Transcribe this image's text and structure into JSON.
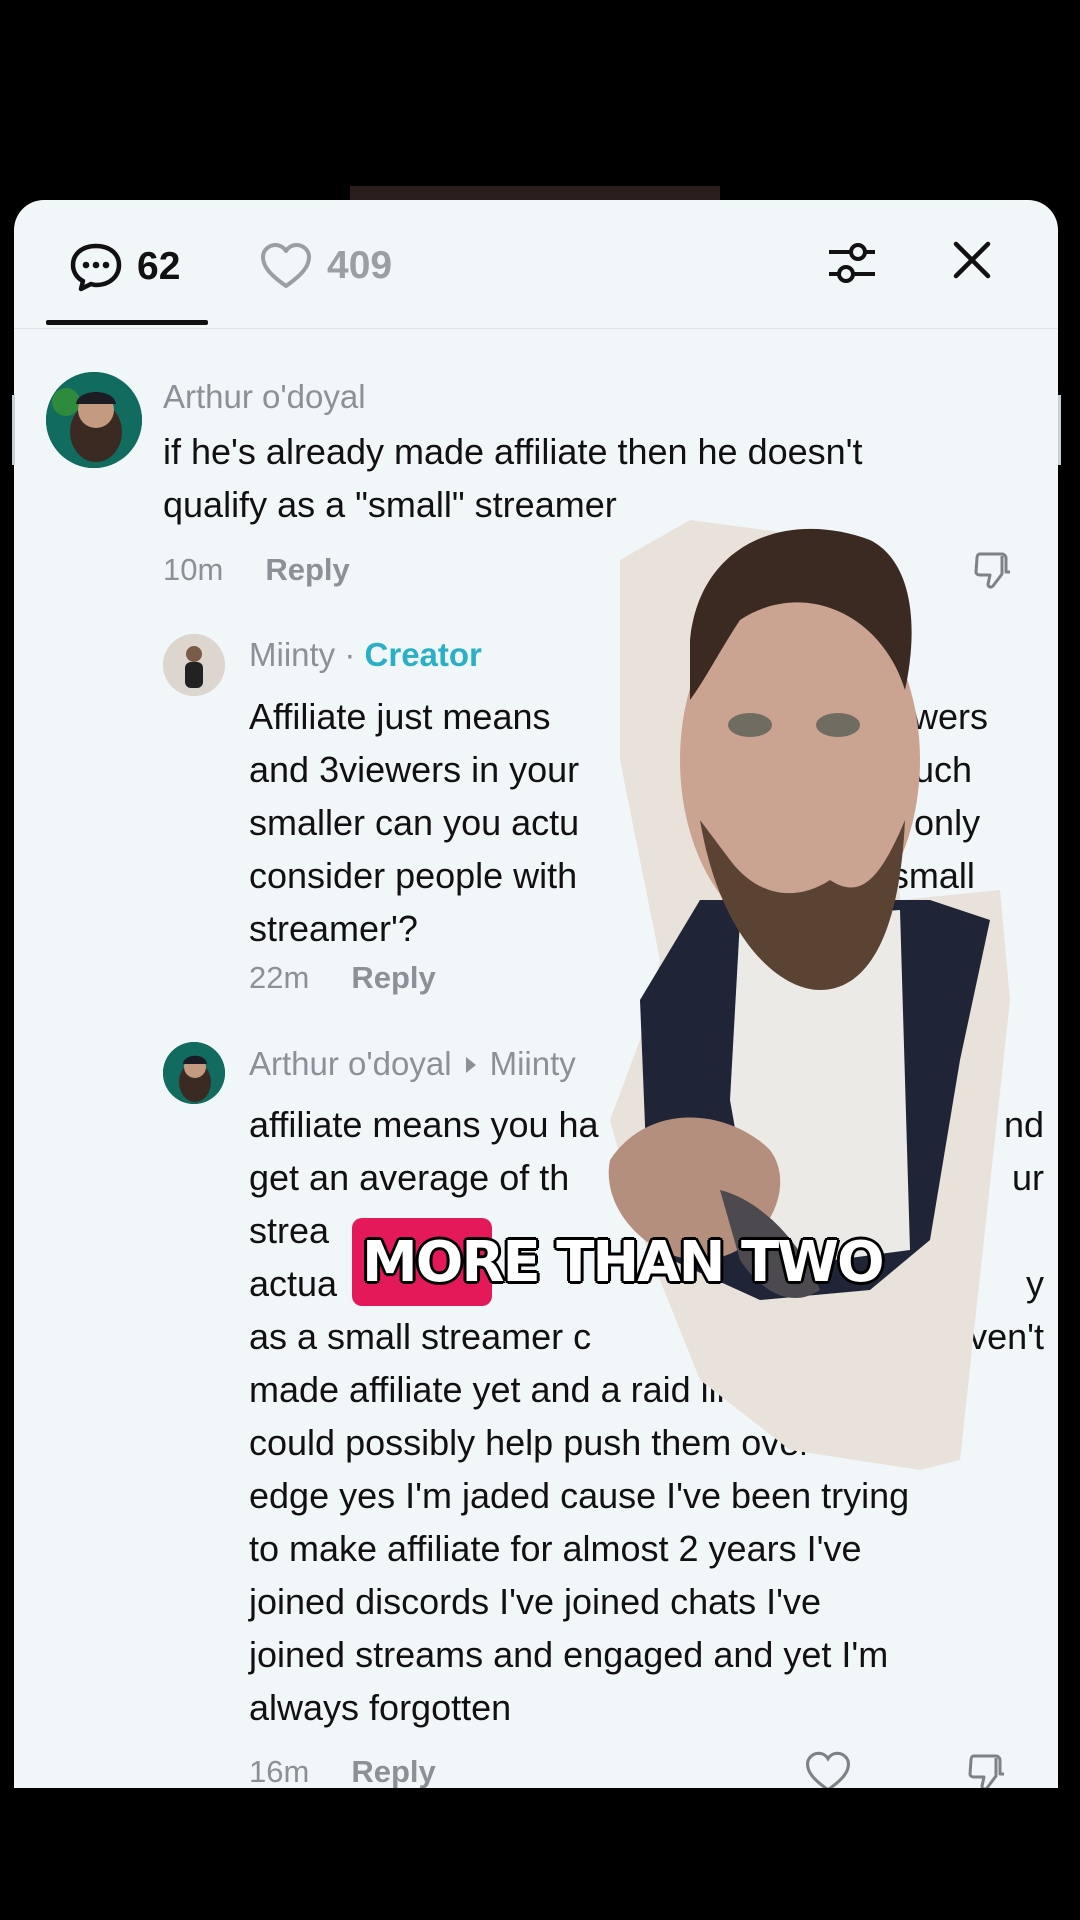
{
  "tabs": {
    "comments_count": "62",
    "likes_count": "409"
  },
  "icons": {
    "comments": "comment-bubble-icon",
    "likes": "heart-outline-icon",
    "filter": "sliders-icon",
    "close": "close-icon"
  },
  "comments": [
    {
      "author": "Arthur o'doyal",
      "text": "if he's already made affiliate then he doesn't\nqualify as a \"small\" streamer",
      "time": "10m",
      "reply_label": "Reply"
    },
    {
      "author": "Miinty",
      "separator": "·",
      "badge": "Creator",
      "text": "Affiliate just means\nand 3viewers in your\nsmaller can you actu\nconsider people with\nstreamer'?",
      "text_right": "lowers\nmuch\nu only\n'small\n",
      "time": "22m",
      "reply_label": "Reply"
    },
    {
      "author": "Arthur o'doyal",
      "reply_to": "Miinty",
      "text": "affiliate means you ha\nget an average of th\nstrea\nactua\nas a small streamer c\nmade affiliate yet and a raid like this\ncould possibly help push them over that\nedge yes I'm jaded cause I've been trying\nto make affiliate for almost 2 years I've\njoined discords I've joined chats I've\njoined streams and engaged and yet I'm\nalways forgotten",
      "text_right": "nd\nur\n\ny\nhaven't",
      "time": "16m",
      "reply_label": "Reply"
    }
  ],
  "caption": {
    "text": "MORE THAN TWO",
    "highlight_color": "#e3195a"
  },
  "colors": {
    "sheet_bg": "#f1f6f9",
    "creator_badge": "#2ab0c6",
    "muted_text": "#8c9197"
  }
}
